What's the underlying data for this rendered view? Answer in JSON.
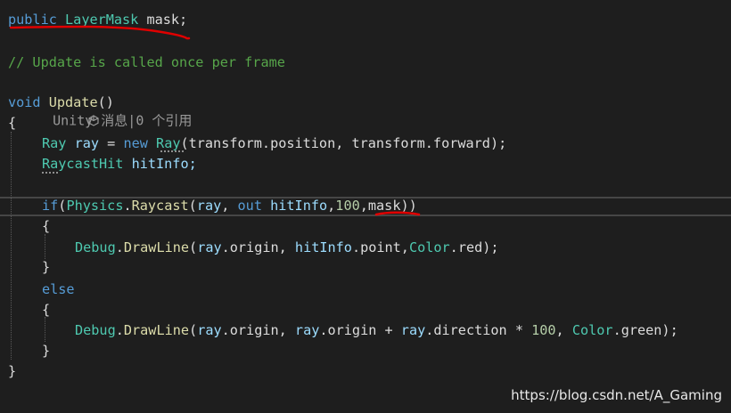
{
  "editor": {
    "line1": {
      "public": "public",
      "type": "LayerMask",
      "rest": " mask;"
    },
    "comment": "// Update is called once per frame",
    "codelens": "Unity 消息|0 个引用",
    "update_sig": {
      "void": "void",
      "name": "Update",
      "parens": "()"
    },
    "open_brace": "{",
    "ray_line": {
      "type": "Ray",
      "var": " ray",
      "eq": " = ",
      "new": "new",
      "sp": " ",
      "ctor": "Ray",
      "args": "(transform.position, transform.forward);"
    },
    "hit_line": {
      "type": "RaycastHit",
      "var": " hitInfo;"
    },
    "if_line": {
      "if": "if",
      "p1": "(",
      "cls": "Physics",
      "dot": ".",
      "fn": "Raycast",
      "p2": "(",
      "ray": "ray",
      "comma1": ", ",
      "out": "out",
      "sp": " ",
      "hit": "hitInfo",
      "comma2": ",",
      "num": "100",
      "comma3": ",",
      "mask": "mask",
      "close": "))"
    },
    "inner_open_1": "{",
    "debug_line_1": {
      "cls": "Debug",
      "dot": ".",
      "fn": "DrawLine",
      "p": "(",
      "a": "ray",
      "b": ".origin, ",
      "c": "hitInfo",
      "d": ".point,",
      "e": "Color",
      "f": ".red);"
    },
    "inner_close_1": "}",
    "else": "else",
    "inner_open_2": "{",
    "debug_line_2": {
      "cls": "Debug",
      "dot": ".",
      "fn": "DrawLine",
      "p": "(",
      "a": "ray",
      "b": ".origin, ",
      "c": "ray",
      "d": ".origin + ",
      "e": "ray",
      "f": ".direction * ",
      "num": "100",
      "g": ", ",
      "h": "Color",
      "i": ".green);"
    },
    "inner_close_2": "}",
    "close_brace": "}"
  },
  "icons": {
    "codelens": "unity-cube-icon"
  },
  "colors": {
    "background": "#1e1e1e",
    "keyword": "#569cd6",
    "type": "#4ec9b0",
    "method": "#dcdcaa",
    "identifier": "#9cdcfe",
    "number": "#b5cea8",
    "comment": "#57a64a",
    "annotation": "#e00000"
  },
  "watermark": "https://blog.csdn.net/A_Gaming"
}
